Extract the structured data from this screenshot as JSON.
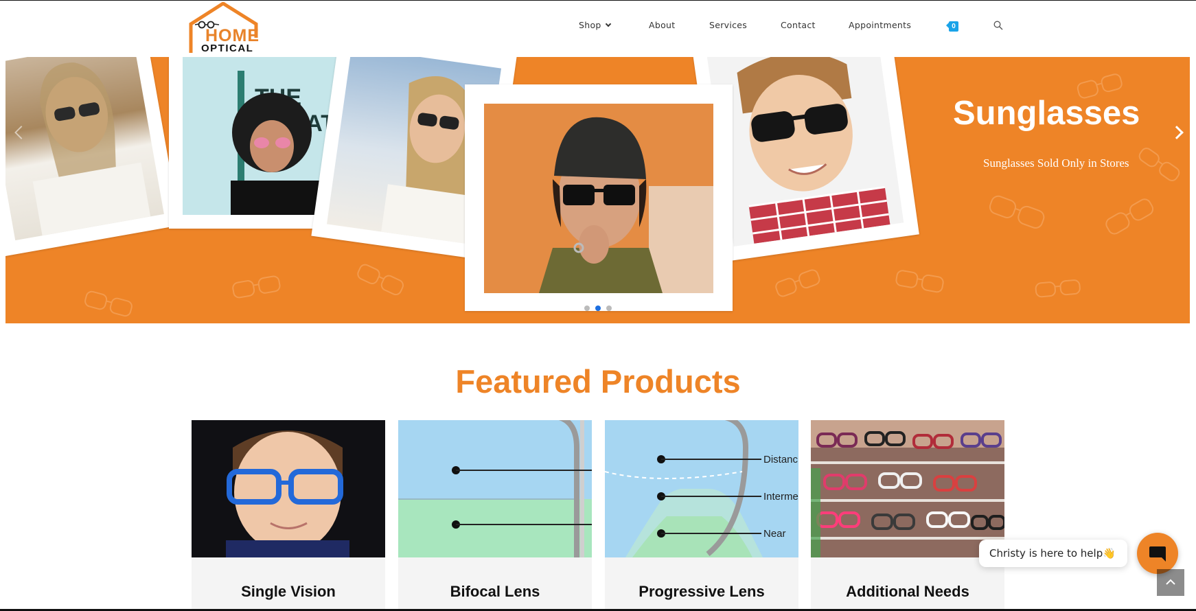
{
  "brand": {
    "logo_line1": "HOME",
    "logo_line2": "OPTICAL",
    "colors": {
      "accent": "#ee8427",
      "badge": "#1aa3e8",
      "dot_active": "#1d6fe0"
    }
  },
  "nav": {
    "items": [
      {
        "label": "Shop",
        "has_dropdown": true
      },
      {
        "label": "About"
      },
      {
        "label": "Services"
      },
      {
        "label": "Contact"
      },
      {
        "label": "Appointments"
      }
    ],
    "cart_count": "0",
    "cart_icon": "cart-icon",
    "search_icon": "search-icon"
  },
  "hero": {
    "title": "Sunglasses",
    "subtitle": "Sunglasses Sold Only in Stores",
    "slide_count": 3,
    "active_slide": 2
  },
  "featured": {
    "title": "Featured Products",
    "products": [
      {
        "label": "Single Vision"
      },
      {
        "label": "Bifocal Lens"
      },
      {
        "label": "Progressive Lens"
      },
      {
        "label": "Additional Needs"
      }
    ]
  },
  "diagram_labels": {
    "distance": "Distanc",
    "intermediate": "Interme",
    "near": "Near"
  },
  "chat": {
    "message": "Christy is here to help",
    "emoji": "👋"
  }
}
